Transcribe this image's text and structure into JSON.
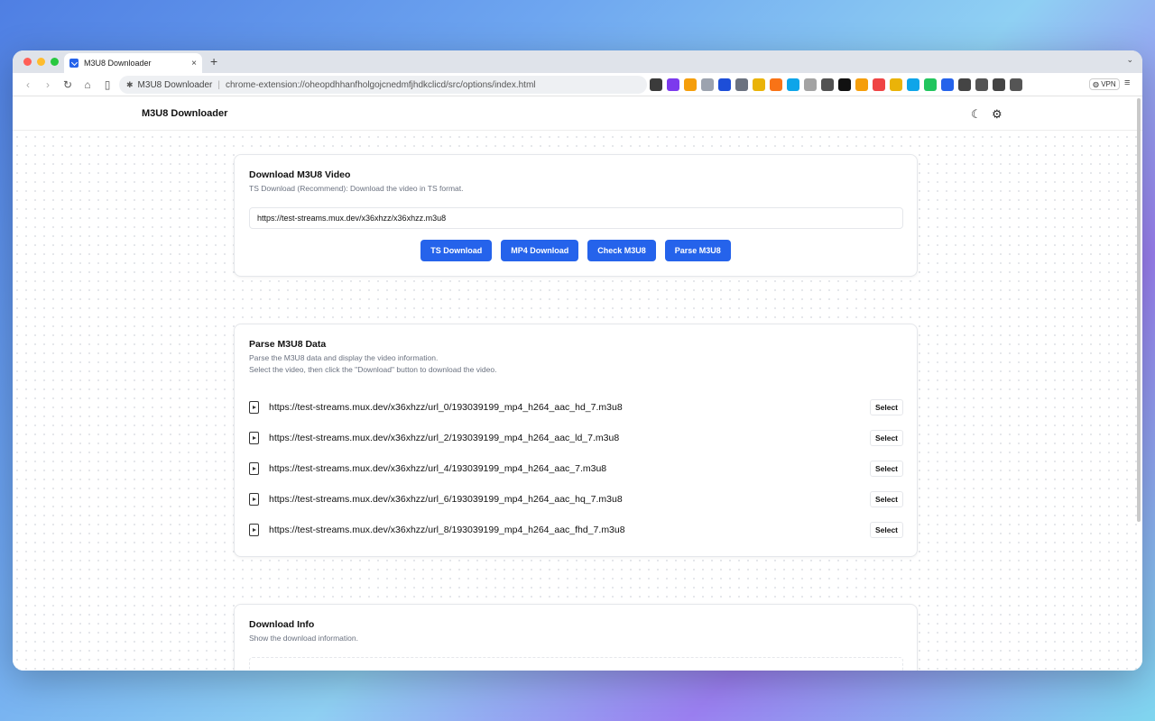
{
  "browser": {
    "tab_title": "M3U8 Downloader",
    "new_tab": "+",
    "close": "×",
    "omnibox": {
      "ext_name": "M3U8 Downloader",
      "separator": "|",
      "url": "chrome-extension://oheopdhhanfholgojcnedmfjhdkclicd/src/options/index.html"
    },
    "vpn_label": "VPN",
    "extension_colors": [
      "#3b3b3b",
      "#7c3aed",
      "#f59e0b",
      "#9ca3af",
      "#1d4ed8",
      "#6b7280",
      "#eab308",
      "#f97316",
      "#0ea5e9",
      "#a3a3a3",
      "#525252",
      "#111111",
      "#f59e0b",
      "#ef4444",
      "#eab308",
      "#0ea5e9",
      "#22c55e",
      "#2563eb",
      "#444444",
      "#555555",
      "#444444",
      "#555555"
    ]
  },
  "header": {
    "brand": "M3U8 Downloader",
    "theme_icon": "☾",
    "settings_icon": "⚙"
  },
  "download_card": {
    "title": "Download M3U8 Video",
    "desc": "TS Download (Recommend): Download the video in TS format.",
    "input_value": "https://test-streams.mux.dev/x36xhzz/x36xhzz.m3u8",
    "buttons": [
      "TS Download",
      "MP4 Download",
      "Check M3U8",
      "Parse M3U8"
    ]
  },
  "parse_card": {
    "title": "Parse M3U8 Data",
    "desc1": "Parse the M3U8 data and display the video information.",
    "desc2": "Select the video, then click the \"Download\" button to download the video.",
    "select_label": "Select",
    "items": [
      "https://test-streams.mux.dev/x36xhzz/url_0/193039199_mp4_h264_aac_hd_7.m3u8",
      "https://test-streams.mux.dev/x36xhzz/url_2/193039199_mp4_h264_aac_ld_7.m3u8",
      "https://test-streams.mux.dev/x36xhzz/url_4/193039199_mp4_h264_aac_7.m3u8",
      "https://test-streams.mux.dev/x36xhzz/url_6/193039199_mp4_h264_aac_hq_7.m3u8",
      "https://test-streams.mux.dev/x36xhzz/url_8/193039199_mp4_h264_aac_fhd_7.m3u8"
    ]
  },
  "info_card": {
    "title": "Download Info",
    "desc": "Show the download information."
  }
}
